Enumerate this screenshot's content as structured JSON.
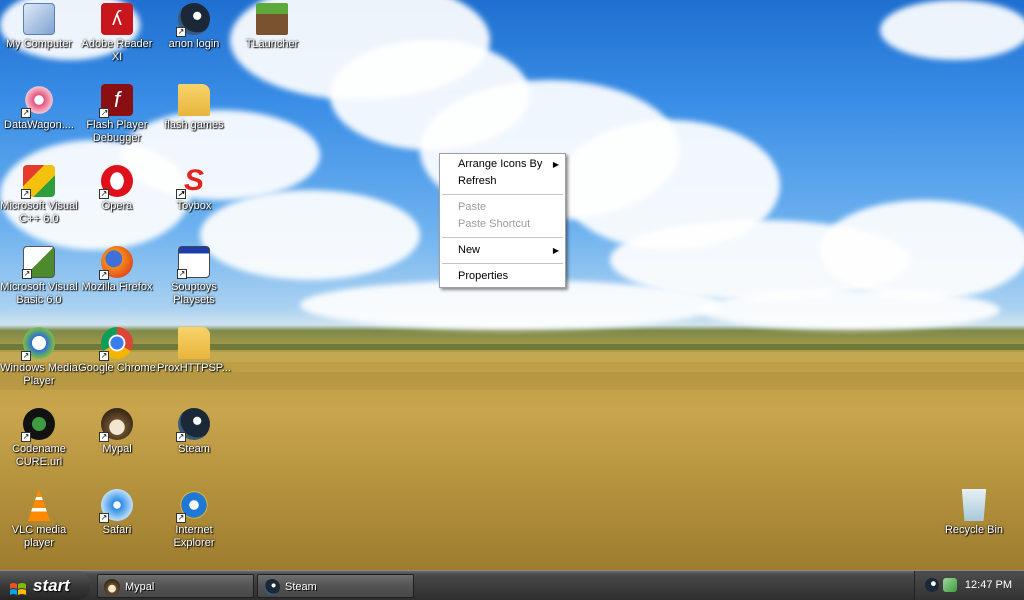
{
  "desktop": {
    "icons": [
      {
        "label": "My Computer",
        "icon": "computer-icon"
      },
      {
        "label": "Adobe Reader XI",
        "icon": "adobe-reader-icon"
      },
      {
        "label": "anon login",
        "icon": "steam-icon"
      },
      {
        "label": "TLauncher",
        "icon": "minecraft-icon"
      },
      {
        "label": "DataWagon....",
        "icon": "datawagon-icon"
      },
      {
        "label": "Flash Player Debugger",
        "icon": "flash-icon"
      },
      {
        "label": "flash games",
        "icon": "folder-icon"
      },
      {
        "label": "Microsoft Visual C++ 6.0",
        "icon": "visual-cpp-icon"
      },
      {
        "label": "Opera",
        "icon": "opera-icon"
      },
      {
        "label": "Toybox",
        "icon": "toybox-icon"
      },
      {
        "label": "Microsoft Visual Basic 6.0",
        "icon": "visual-basic-icon"
      },
      {
        "label": "Mozilla Firefox",
        "icon": "firefox-icon"
      },
      {
        "label": "Souptoys Playsets",
        "icon": "window-icon"
      },
      {
        "label": "Windows Media Player",
        "icon": "media-player-icon"
      },
      {
        "label": "Google Chrome",
        "icon": "chrome-icon"
      },
      {
        "label": "ProxHTTPSP...",
        "icon": "folder-icon"
      },
      {
        "label": "Codename CURE.url",
        "icon": "codename-cure-icon"
      },
      {
        "label": "Mypal",
        "icon": "mypal-icon"
      },
      {
        "label": "Steam",
        "icon": "steam-icon"
      },
      {
        "label": "VLC media player",
        "icon": "vlc-icon"
      },
      {
        "label": "Safari",
        "icon": "safari-icon"
      },
      {
        "label": "Internet Explorer",
        "icon": "ie-icon"
      },
      {
        "label": "Recycle Bin",
        "icon": "recycle-bin-icon"
      }
    ]
  },
  "context_menu": {
    "arrange": "Arrange Icons By",
    "refresh": "Refresh",
    "paste": "Paste",
    "paste_shortcut": "Paste Shortcut",
    "new": "New",
    "properties": "Properties"
  },
  "taskbar": {
    "start_label": "start",
    "tasks": [
      {
        "label": "Mypal",
        "icon": "mypal-icon"
      },
      {
        "label": "Steam",
        "icon": "steam-icon"
      }
    ],
    "clock": "12:47 PM"
  },
  "colors": {
    "menu_disabled": "#9d9d9d",
    "taskbar": "#3d3d3d"
  }
}
